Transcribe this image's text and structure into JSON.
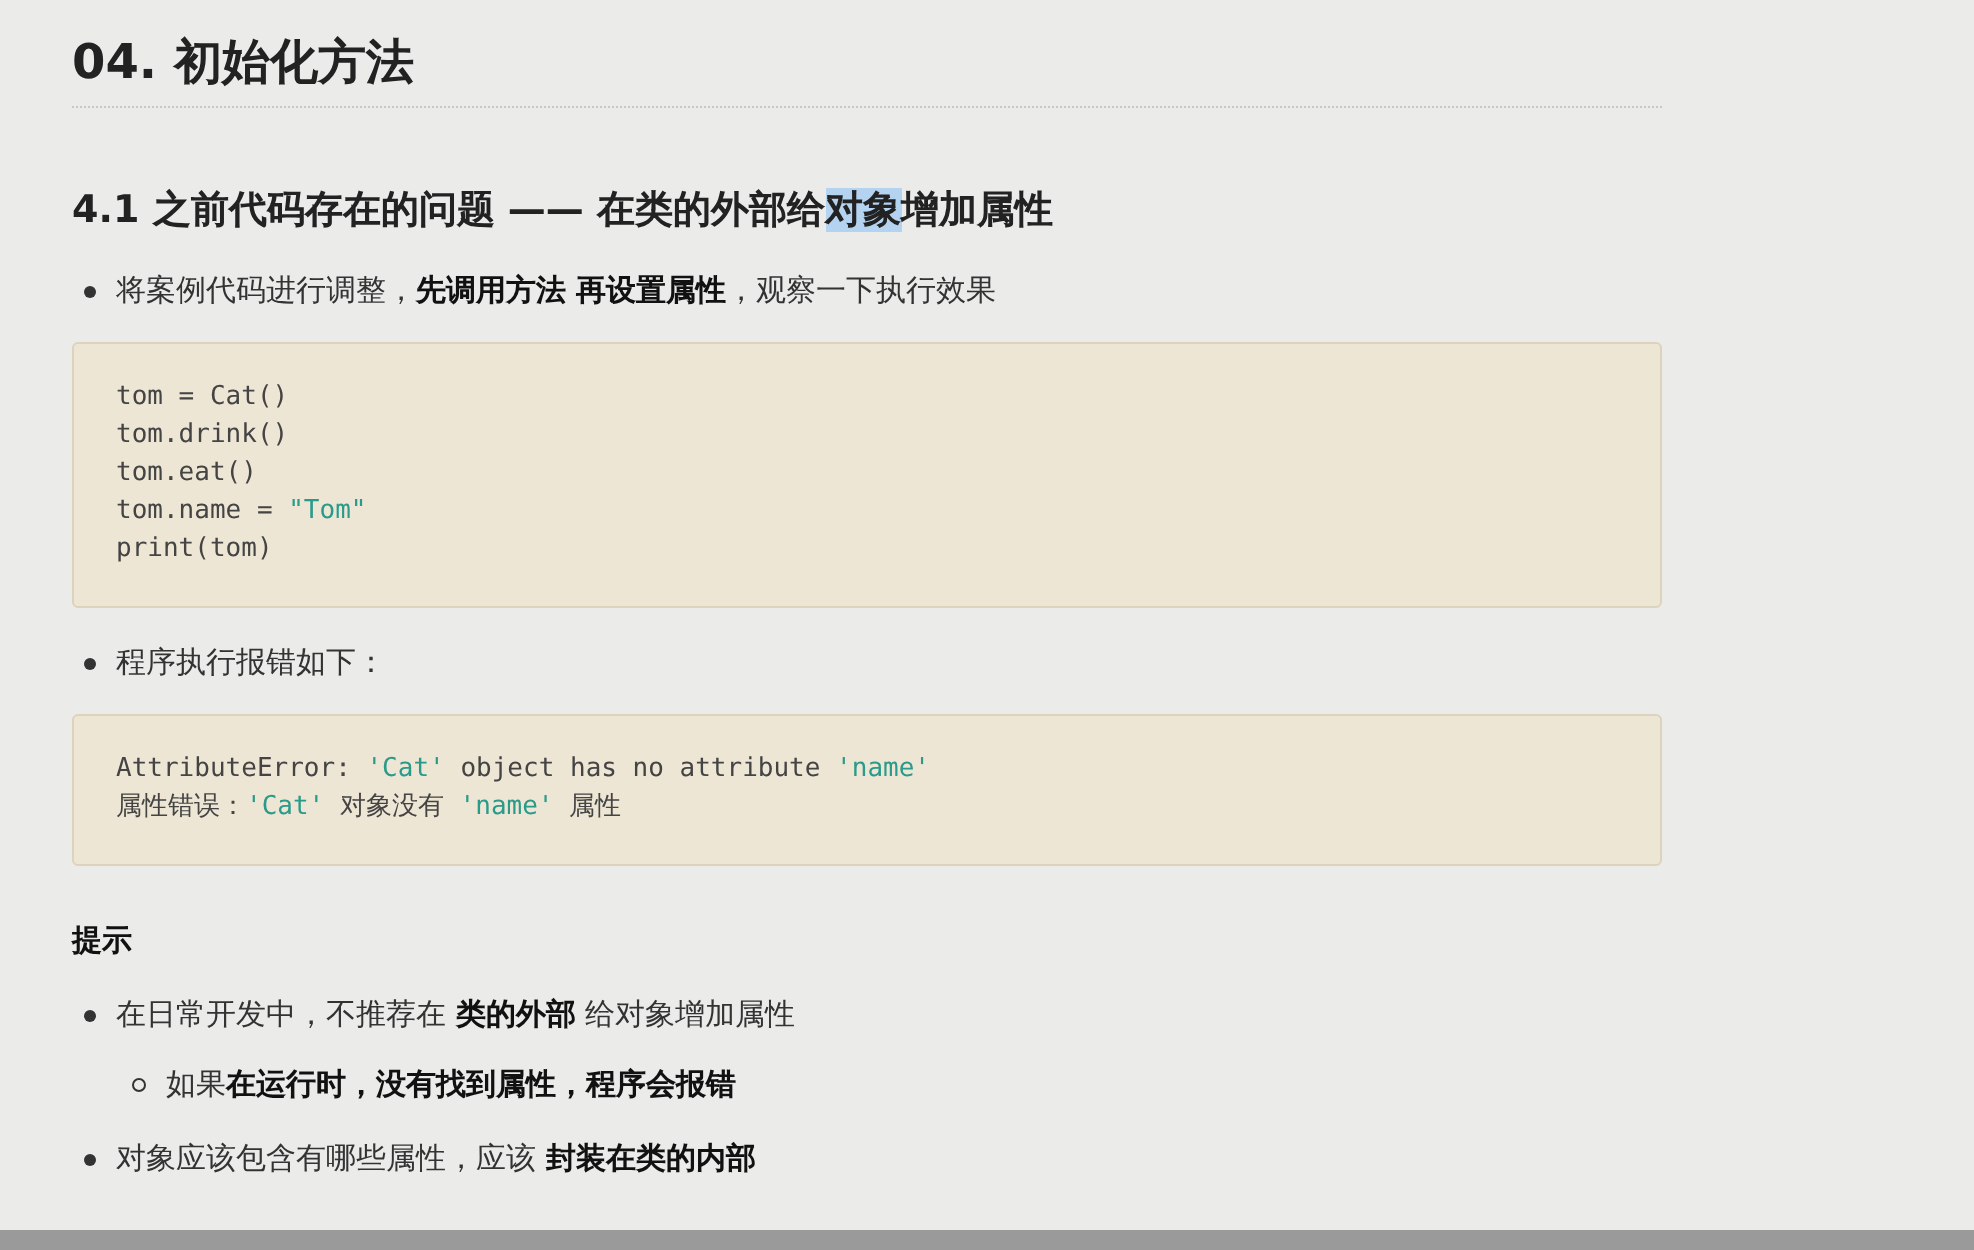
{
  "heading_1": "04. 初始化方法",
  "heading_2": {
    "parts": [
      {
        "text": "4.1 之前代码存在的问题 —— 在类的外部给",
        "selected": false
      },
      {
        "text": "对象",
        "selected": true
      },
      {
        "text": "增加属性",
        "selected": false
      }
    ]
  },
  "content": [
    {
      "kind": "bullet",
      "text": "将案例代码进行调整，**先调用方法 再设置属性**，观察一下执行效果"
    },
    {
      "kind": "code",
      "lines": [
        [
          {
            "kind": "plain",
            "text": "tom = Cat()"
          }
        ],
        [
          {
            "kind": "plain",
            "text": "tom.drink()"
          }
        ],
        [
          {
            "kind": "plain",
            "text": "tom.eat()"
          }
        ],
        [
          {
            "kind": "plain",
            "text": "tom.name = "
          },
          {
            "kind": "string",
            "text": "\"Tom\""
          }
        ],
        [
          {
            "kind": "plain",
            "text": "print(tom)"
          }
        ]
      ]
    },
    {
      "kind": "bullet",
      "text": "程序执行报错如下："
    },
    {
      "kind": "code",
      "lines": [
        [
          {
            "kind": "plain",
            "text": "AttributeError: "
          },
          {
            "kind": "string",
            "text": "'Cat'"
          },
          {
            "kind": "plain",
            "text": " object has no attribute "
          },
          {
            "kind": "string",
            "text": "'name'"
          }
        ],
        [
          {
            "kind": "plain",
            "text": "属性错误："
          },
          {
            "kind": "string",
            "text": "'Cat'"
          },
          {
            "kind": "plain",
            "text": " 对象没有 "
          },
          {
            "kind": "string",
            "text": "'name'"
          },
          {
            "kind": "plain",
            "text": " 属性"
          }
        ]
      ]
    },
    {
      "kind": "label",
      "text": "提示"
    },
    {
      "kind": "bullet",
      "text": "在日常开发中，不推荐在 **类的外部** 给对象增加属性",
      "children": [
        {
          "text": "如果**在运行时，没有找到属性，程序会报错**"
        }
      ]
    },
    {
      "kind": "bullet",
      "text": "对象应该包含有哪些属性，应该 **封装在类的内部**"
    }
  ]
}
